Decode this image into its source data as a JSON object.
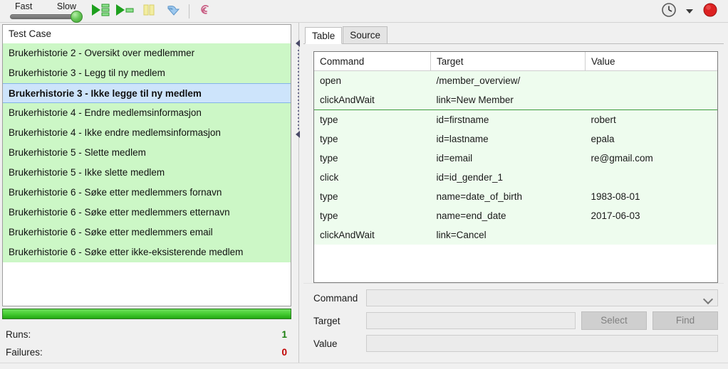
{
  "toolbar": {
    "speed_fast_label": "Fast",
    "speed_slow_label": "Slow",
    "buttons": [
      {
        "name": "play-entire-suite-button",
        "icon": "play-all-icon"
      },
      {
        "name": "play-current-test-case-button",
        "icon": "play-one-icon"
      },
      {
        "name": "pause-resume-button",
        "icon": "pause-icon"
      },
      {
        "name": "step-button",
        "icon": "step-arrow-icon"
      },
      {
        "name": "apply-rollup-button",
        "icon": "spiral-icon"
      }
    ],
    "clock_icon": "clock-icon",
    "dropdown_icon": "chevron-down-icon",
    "record_icon": "record-button-icon",
    "record_color": "#dd2222"
  },
  "left_panel": {
    "header": "Test Case",
    "items": [
      {
        "label": "Brukerhistorie 2 - Oversikt over medlemmer",
        "selected": false
      },
      {
        "label": "Brukerhistorie 3 - Legg til ny medlem",
        "selected": false
      },
      {
        "label": "Brukerhistorie 3 - Ikke legge til ny medlem",
        "selected": true
      },
      {
        "label": "Brukerhistorie 4 - Endre medlemsinformasjon",
        "selected": false
      },
      {
        "label": "Brukerhistorie 4 - Ikke endre medlemsinformasjon",
        "selected": false
      },
      {
        "label": "Brukerhistorie 5 - Slette medlem",
        "selected": false
      },
      {
        "label": "Brukerhistorie 5 - Ikke slette medlem",
        "selected": false
      },
      {
        "label": "Brukerhistorie 6 - Søke etter medlemmers fornavn",
        "selected": false
      },
      {
        "label": "Brukerhistorie 6 - Søke etter medlemmers etternavn",
        "selected": false
      },
      {
        "label": "Brukerhistorie 6 - Søke etter medlemmers email",
        "selected": false
      },
      {
        "label": "Brukerhistorie 6 - Søke etter ikke-eksisterende medlem",
        "selected": false
      }
    ],
    "progress_percent": 100,
    "progress_color": "#2fbd1c",
    "stats": {
      "runs_label": "Runs:",
      "runs_value": "1",
      "runs_color": "#197e0c",
      "failures_label": "Failures:",
      "failures_value": "0",
      "failures_color": "#c00000"
    }
  },
  "right_panel": {
    "tabs": [
      {
        "label": "Table",
        "active": true
      },
      {
        "label": "Source",
        "active": false
      }
    ],
    "table": {
      "headers": [
        "Command",
        "Target",
        "Value"
      ],
      "rows": [
        {
          "command": "open",
          "target": "/member_overview/",
          "value": "",
          "group_end": false
        },
        {
          "command": "clickAndWait",
          "target": "link=New Member",
          "value": "",
          "group_end": true
        },
        {
          "command": "type",
          "target": "id=firstname",
          "value": "robert",
          "group_end": false
        },
        {
          "command": "type",
          "target": "id=lastname",
          "value": "epala",
          "group_end": false
        },
        {
          "command": "type",
          "target": "id=email",
          "value": "re@gmail.com",
          "group_end": false
        },
        {
          "command": "click",
          "target": "id=id_gender_1",
          "value": "",
          "group_end": false
        },
        {
          "command": "type",
          "target": "name=date_of_birth",
          "value": "1983-08-01",
          "group_end": false
        },
        {
          "command": "type",
          "target": "name=end_date",
          "value": "2017-06-03",
          "group_end": false
        },
        {
          "command": "clickAndWait",
          "target": "link=Cancel",
          "value": "",
          "group_end": false
        }
      ]
    },
    "form": {
      "command_label": "Command",
      "command_value": "",
      "command_placeholder": "",
      "target_label": "Target",
      "target_value": "",
      "target_placeholder": "",
      "value_label": "Value",
      "value_value": "",
      "value_placeholder": "",
      "select_button": "Select",
      "find_button": "Find"
    }
  }
}
